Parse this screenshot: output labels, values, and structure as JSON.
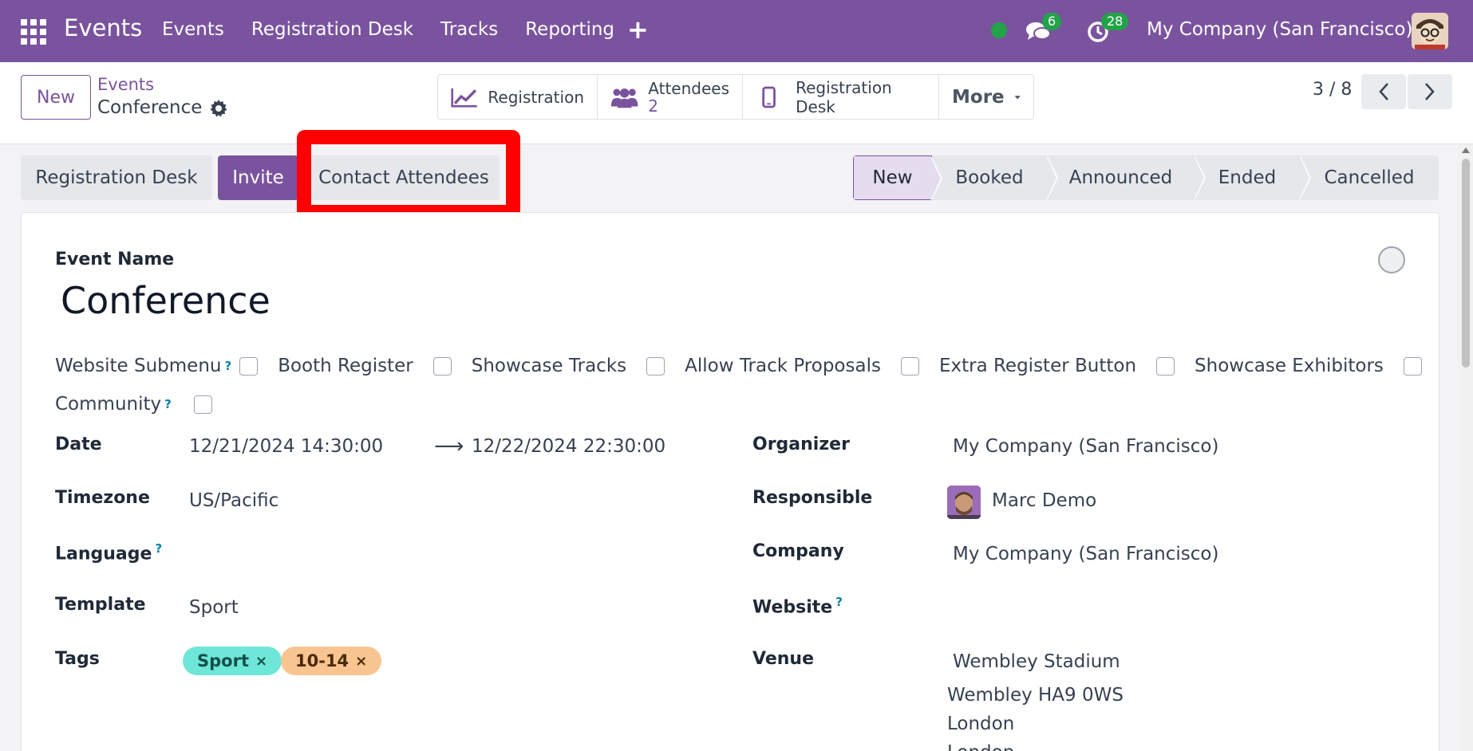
{
  "navbar": {
    "app_name": "Events",
    "menu": [
      "Events",
      "Registration Desk",
      "Tracks",
      "Reporting"
    ],
    "plus": "+",
    "chat_count": "6",
    "activity_count": "28",
    "company": "My Company (San Francisco)",
    "accent": "#7a539e"
  },
  "control": {
    "new_label": "New",
    "breadcrumb_parent": "Events",
    "breadcrumb_current": "Conference",
    "smart_buttons": {
      "registration": "Registration",
      "attendees": "Attendees",
      "attendees_count": "2",
      "registration_desk": "Registration Desk",
      "more": "More"
    },
    "pager": "3 / 8"
  },
  "actions": {
    "registration_desk": "Registration Desk",
    "invite": "Invite",
    "contact_attendees": "Contact Attendees"
  },
  "stages": [
    "New",
    "Booked",
    "Announced",
    "Ended",
    "Cancelled"
  ],
  "form": {
    "event_name_label": "Event Name",
    "event_name": "Conference",
    "website_submenu_label": "Website Submenu",
    "help_mark": "?",
    "checkboxes": {
      "booth_register": "Booth Register",
      "showcase_tracks": "Showcase Tracks",
      "allow_track_proposals": "Allow Track Proposals",
      "extra_register_button": "Extra Register Button",
      "showcase_exhibitors": "Showcase Exhibitors",
      "community": "Community"
    },
    "date_label": "Date",
    "date_start": "12/21/2024 14:30:00",
    "date_arrow": "⟶",
    "date_end": "12/22/2024 22:30:00",
    "timezone_label": "Timezone",
    "timezone": "US/Pacific",
    "language_label": "Language",
    "template_label": "Template",
    "template": "Sport",
    "tags_label": "Tags",
    "tags": [
      "Sport",
      "10-14"
    ],
    "tag_remove": "×",
    "organizer_label": "Organizer",
    "organizer": "My Company (San Francisco)",
    "responsible_label": "Responsible",
    "responsible": "Marc Demo",
    "company_label": "Company",
    "company": "My Company (San Francisco)",
    "website_label": "Website",
    "venue_label": "Venue",
    "venue_name": "Wembley Stadium",
    "venue_line1": "Wembley HA9 0WS",
    "venue_line2": "London",
    "venue_line3": "London"
  }
}
